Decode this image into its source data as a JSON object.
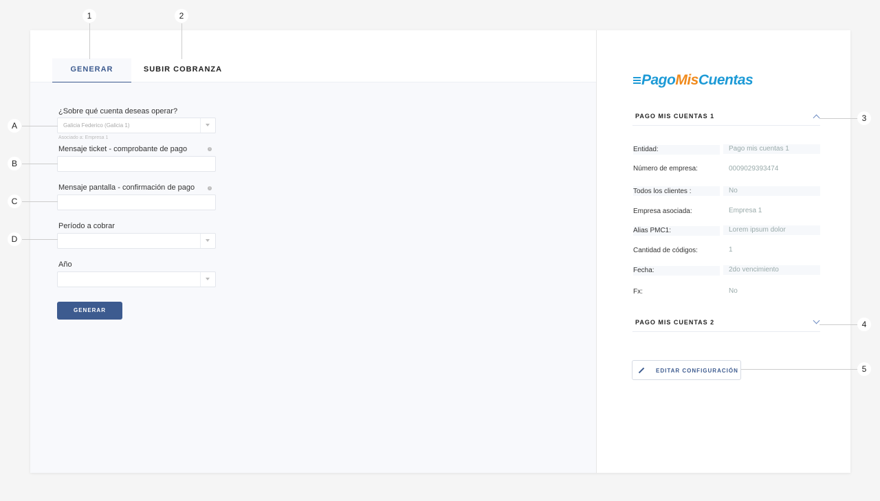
{
  "tabs": {
    "generar": "GENERAR",
    "subir": "SUBIR COBRANZA"
  },
  "form": {
    "account_label": "¿Sobre qué cuenta deseas operar?",
    "account_value": "Galicia Federico (Galicia 1)",
    "account_hint": "Asociado a: Empresa 1",
    "ticket_label": "Mensaje ticket - comprobante de pago",
    "screen_label": "Mensaje pantalla - confirmación de pago",
    "period_label": "Período a cobrar",
    "year_label": "Año",
    "submit_label": "GENERAR"
  },
  "logo": {
    "part1": "Pago",
    "part2": "Mis",
    "part3": "Cuentas"
  },
  "sections": {
    "s1": "PAGO MIS CUENTAS 1",
    "s2": "PAGO MIS CUENTAS 2"
  },
  "details": [
    {
      "key": "Entidad:",
      "value": "Pago mis cuentas 1"
    },
    {
      "key": "Número de empresa:",
      "value": "0009029393474"
    },
    {
      "key": "Todos los clientes :",
      "value": "No"
    },
    {
      "key": "Empresa asociada:",
      "value": "Empresa 1"
    },
    {
      "key": "Alias PMC1:",
      "value": "Lorem ipsum dolor"
    },
    {
      "key": "Cantidad de códigos:",
      "value": "1"
    },
    {
      "key": "Fecha:",
      "value": "2do vencimiento"
    },
    {
      "key": "Fx:",
      "value": "No"
    }
  ],
  "edit_label": "EDITAR CONFIGURACIÓN",
  "callouts": {
    "c1": "1",
    "c2": "2",
    "c3": "3",
    "c4": "4",
    "c5": "5",
    "cA": "A",
    "cB": "B",
    "cC": "C",
    "cD": "D"
  }
}
